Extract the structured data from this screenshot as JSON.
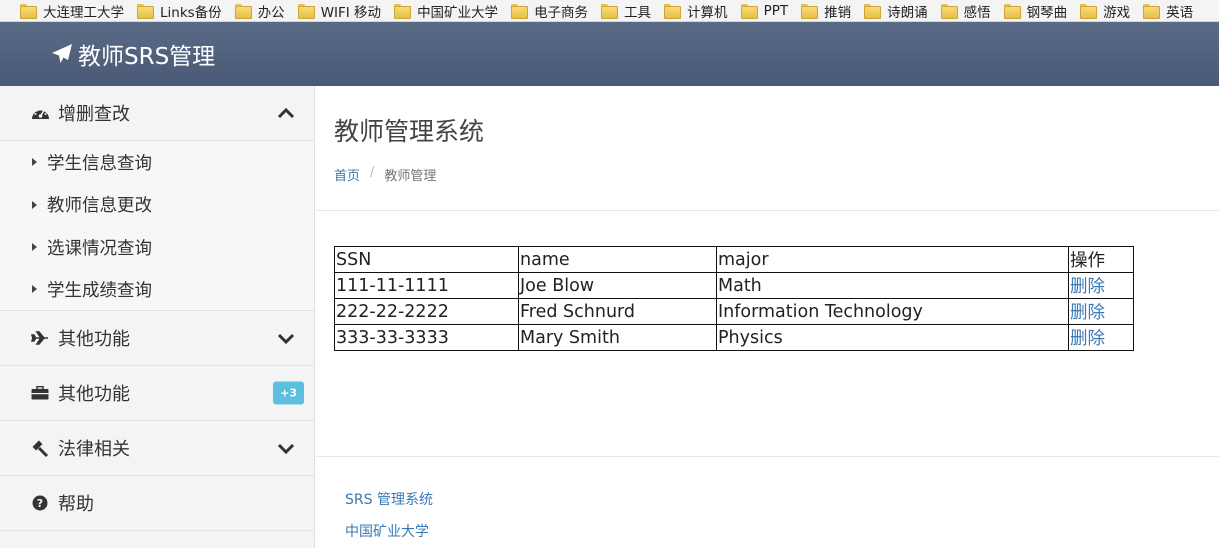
{
  "bookmarks": [
    "大连理工大学",
    "Links备份",
    "办公",
    "WIFI 移动",
    "中国矿业大学",
    "电子商务",
    "工具",
    "计算机",
    "PPT",
    "推销",
    "诗朗诵",
    "感悟",
    "钢琴曲",
    "游戏",
    "英语"
  ],
  "navbar": {
    "brand": "教师SRS管理"
  },
  "sidebar": {
    "crud": {
      "label": "增删查改",
      "items": [
        "学生信息查询",
        "教师信息更改",
        "选课情况查询",
        "学生成绩查询"
      ]
    },
    "other1": {
      "label": "其他功能"
    },
    "other2": {
      "label": "其他功能",
      "badge": "+3"
    },
    "law": {
      "label": "法律相关"
    },
    "help": {
      "label": "帮助"
    }
  },
  "main": {
    "title": "教师管理系统",
    "breadcrumb": {
      "home": "首页",
      "separator": "/",
      "current": "教师管理"
    }
  },
  "table": {
    "headers": [
      "SSN",
      "name",
      "major",
      "操作"
    ],
    "rows": [
      {
        "ssn": "111-11-1111",
        "name": "Joe Blow",
        "major": "Math",
        "action": "删除"
      },
      {
        "ssn": "222-22-2222",
        "name": "Fred Schnurd",
        "major": "Information Technology",
        "action": "删除"
      },
      {
        "ssn": "333-33-3333",
        "name": "Mary Smith",
        "major": "Physics",
        "action": "删除"
      }
    ]
  },
  "footer": {
    "link1": "SRS 管理系统",
    "link2": "中国矿业大学"
  },
  "colors": {
    "navbar": "#4f5f7b",
    "link": "#3a78b5",
    "badge": "#5bc0de",
    "sidebar_bg": "#f4f4f4"
  }
}
